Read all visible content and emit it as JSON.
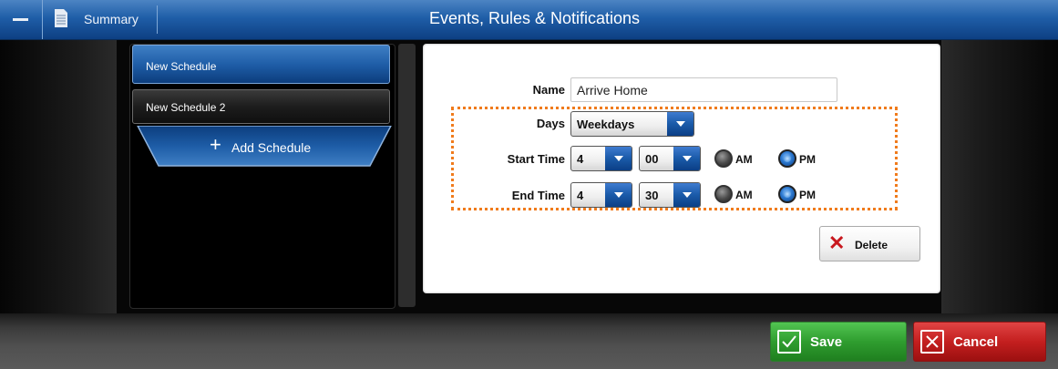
{
  "header": {
    "menu_icon": "minus-icon",
    "summary_icon": "document-icon",
    "summary_label": "Summary",
    "title": "Events, Rules & Notifications"
  },
  "schedules": {
    "items": [
      {
        "label": "New Schedule",
        "active": true
      },
      {
        "label": "New Schedule 2",
        "active": false
      }
    ],
    "add_label": "Add Schedule",
    "add_icon": "plus-icon"
  },
  "form": {
    "name_label": "Name",
    "name_value": "Arrive Home",
    "days_label": "Days",
    "days_value": "Weekdays",
    "start_label": "Start Time",
    "start_hour": "4",
    "start_minute": "00",
    "start_period": "PM",
    "end_label": "End Time",
    "end_hour": "4",
    "end_minute": "30",
    "end_period": "PM",
    "am_label": "AM",
    "pm_label": "PM",
    "delete_label": "Delete",
    "delete_icon": "x-icon"
  },
  "footer": {
    "save_label": "Save",
    "save_icon": "checkmark-icon",
    "cancel_label": "Cancel",
    "cancel_icon": "x-icon"
  },
  "colors": {
    "header_blue": "#1f5ea8",
    "highlight_orange": "#f07b1c",
    "save_green": "#2f9d2f",
    "cancel_red": "#c41f1f",
    "delete_red": "#c8181e"
  }
}
